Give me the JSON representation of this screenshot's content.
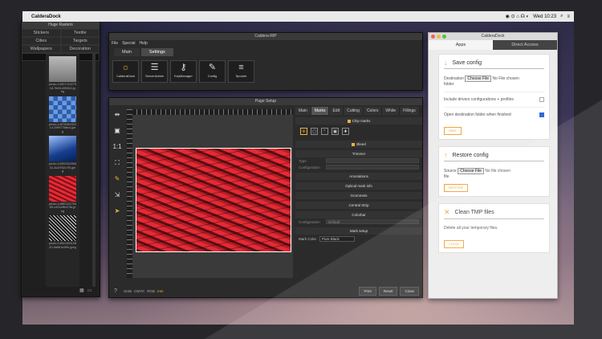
{
  "menubar": {
    "app": "CalderaDock",
    "clock": "Wed 10:23"
  },
  "huge_rasters": {
    "title": "Huge Rasters",
    "tabs": [
      "Stickers",
      "Textile",
      "Cities",
      "Targets",
      "Wallpapers",
      "Decoration"
    ],
    "selected_tab": "Huge Rasters",
    "thumbs": [
      {
        "cap": "photo-1452174327318-7fe51d3f3341.jpeg",
        "color": "#9a9a9a"
      },
      {
        "cap": "photo-1497608152414-25f9775dfc4.jpeg",
        "color": "#3c6fb9"
      },
      {
        "cap": "photo-1490231499431-3c2f762c7f0.jpeg",
        "color": "#173f8f"
      },
      {
        "cap": "photo-1488215175480-c431e8b473d.jpeg",
        "color": "#d22a3b"
      },
      {
        "cap": "photo-1494145910820-9a5b1e3f9c.jpeg",
        "color": "#2b2b2b"
      }
    ]
  },
  "rip": {
    "title": "Caldera RIP",
    "menu": [
      "File",
      "Special",
      "Help"
    ],
    "nav": {
      "main": "Main",
      "settings": "Settings"
    },
    "tools": [
      {
        "label": "CalderaDock",
        "icon": "☼"
      },
      {
        "label": "ServerAdmin",
        "icon": "☰"
      },
      {
        "label": "KeyManager",
        "icon": "⚷"
      },
      {
        "label": "Config",
        "icon": "✎"
      },
      {
        "label": "Spooler",
        "icon": "≡"
      }
    ]
  },
  "page_setup": {
    "title": "Page Setup",
    "tabs": [
      "Main",
      "Marks",
      "Edit",
      "Cutting",
      "Colors",
      "White",
      "Fillings"
    ],
    "sections": {
      "chip": "Chip marks",
      "bleed": "Bleed",
      "trimmer": "Trimmer",
      "annotations": "Annotations",
      "optical": "Optical mark info",
      "grommets": "Grommets",
      "central": "Central Strip",
      "colorbar": "Colorbar",
      "mark_setup": "Mark setup"
    },
    "fields": {
      "type": "Type",
      "config": "Configuration",
      "config_val": "Default",
      "mark_color": "Mark Color",
      "mark_color_val": "Pure Black",
      "edit": "Edit"
    },
    "footer": {
      "help": "?",
      "units": "Units",
      "opt1": "CMYK",
      "opt2": "RGB",
      "opt3": "mm"
    },
    "buttons": {
      "print": "Print",
      "reset": "Reset",
      "close": "Close"
    }
  },
  "dock": {
    "title": "CalderaDock",
    "tabs": [
      "Apps",
      "Direct Access"
    ],
    "save": {
      "title": "Save config",
      "dest": "Destination",
      "choose": "Choose File",
      "nofile": "No File chosen",
      "folder": "folder",
      "chk1": "Include drivers configurations + profiles",
      "chk2": "Open destination folder when finished",
      "btn": "SAVE"
    },
    "restore": {
      "title": "Restore config",
      "source": "Source",
      "choose": "Choose File",
      "nofile": "No file chosen",
      "file": "file",
      "btn": "RESTORE"
    },
    "clean": {
      "title": "Clean TMP files",
      "desc": "Delete all your temporary files.",
      "btn": "CLEAN"
    }
  }
}
